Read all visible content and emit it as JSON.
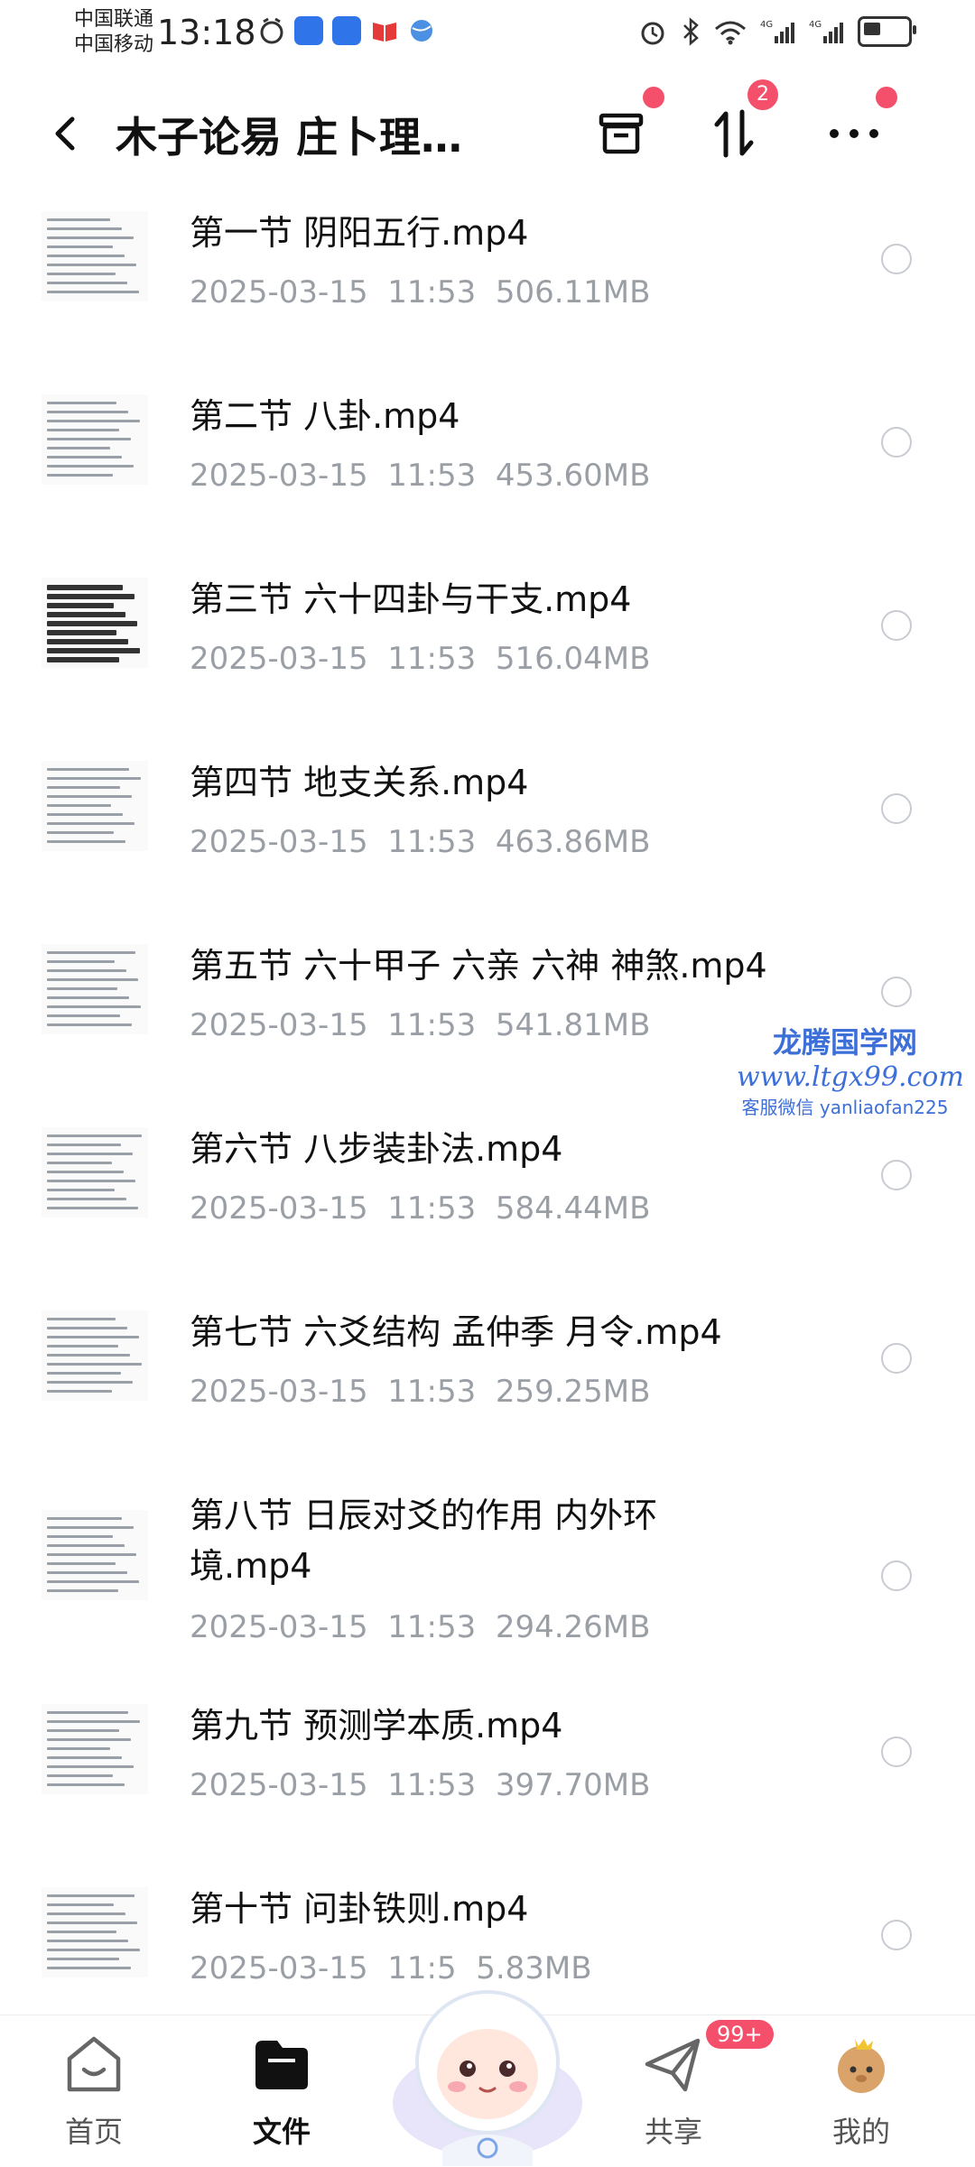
{
  "status_bar": {
    "carrier_1": "中国联通",
    "carrier_2": "中国移动",
    "time": "13:18"
  },
  "header": {
    "title": "木子论易 庄卜理…",
    "transfer_badge": "2"
  },
  "files": [
    {
      "name": "第一节 阴阳五行.mp4",
      "date": "2025-03-15",
      "time": "11:53",
      "size": "506.11MB"
    },
    {
      "name": "第二节 八卦.mp4",
      "date": "2025-03-15",
      "time": "11:53",
      "size": "453.60MB"
    },
    {
      "name": "第三节 六十四卦与干支.mp4",
      "date": "2025-03-15",
      "time": "11:53",
      "size": "516.04MB"
    },
    {
      "name": "第四节 地支关系.mp4",
      "date": "2025-03-15",
      "time": "11:53",
      "size": "463.86MB"
    },
    {
      "name": "第五节 六十甲子 六亲 六神 神煞.mp4",
      "date": "2025-03-15",
      "time": "11:53",
      "size": "541.81MB"
    },
    {
      "name": "第六节 八步装卦法.mp4",
      "date": "2025-03-15",
      "time": "11:53",
      "size": "584.44MB"
    },
    {
      "name": "第七节  六爻结构 孟仲季 月令.mp4",
      "date": "2025-03-15",
      "time": "11:53",
      "size": "259.25MB"
    },
    {
      "name": "第八节  日辰对爻的作用 内外环境.mp4",
      "date": "2025-03-15",
      "time": "11:53",
      "size": "294.26MB"
    },
    {
      "name": "第九节 预测学本质.mp4",
      "date": "2025-03-15",
      "time": "11:53",
      "size": "397.70MB"
    },
    {
      "name": "第十节 问卦铁则.mp4",
      "date": "2025-03-15",
      "time": "11:5",
      "size": "5.83MB"
    }
  ],
  "watermark": {
    "line1": "龙腾国学网",
    "line2": "www.ltgx99.com",
    "line3": "客服微信 yanliaofan225"
  },
  "bottom_nav": {
    "home": "首页",
    "files": "文件",
    "share": "共享",
    "share_badge": "99+",
    "mine": "我的"
  },
  "colors": {
    "accent_red": "#f4506b",
    "meta_gray": "#9a9fa6",
    "watermark_blue": "#3d6fd8"
  }
}
